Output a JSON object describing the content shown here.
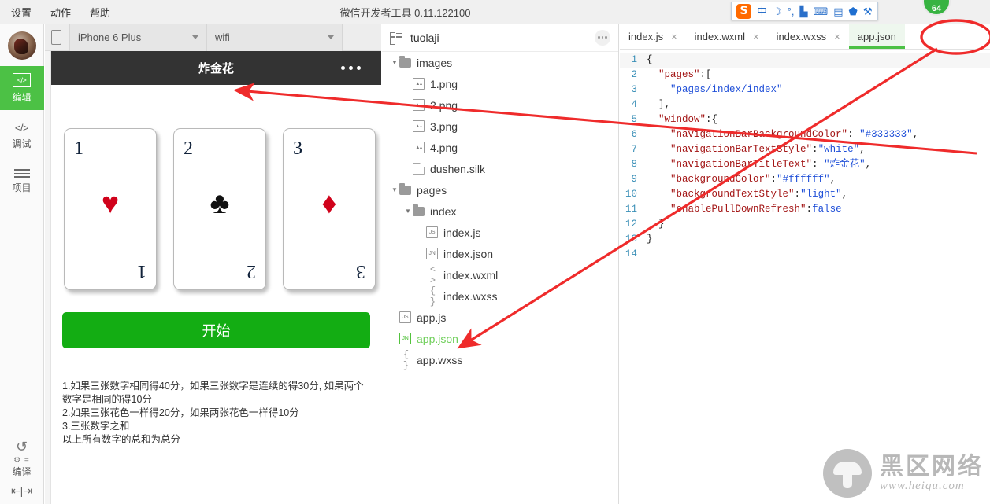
{
  "window": {
    "title": "微信开发者工具 0.11.122100",
    "badge": "64"
  },
  "menubar": {
    "items": [
      {
        "label": "设置",
        "name": "menu-settings"
      },
      {
        "label": "动作",
        "name": "menu-actions"
      },
      {
        "label": "帮助",
        "name": "menu-help"
      }
    ]
  },
  "ime": {
    "logo": "S",
    "icons": [
      "中",
      "☽",
      "°,",
      "▙",
      "⌨",
      "▤",
      "⬟",
      "⚒"
    ]
  },
  "rail": {
    "items": [
      {
        "label": "编辑",
        "glyph": "</>",
        "active": true,
        "name": "rail-edit"
      },
      {
        "label": "调试",
        "glyph": "</>",
        "active": false,
        "name": "rail-debug"
      },
      {
        "label": "项目",
        "glyph": "hamburger",
        "active": false,
        "name": "rail-project"
      }
    ],
    "compile_label": "编译",
    "compile_sub": "⚙ ="
  },
  "simulator": {
    "device": "iPhone 6 Plus",
    "network": "wifi",
    "navbar_title": "炸金花",
    "cards": [
      {
        "number": "1",
        "suit": "♥",
        "color": "red"
      },
      {
        "number": "2",
        "suit": "♣",
        "color": "black"
      },
      {
        "number": "3",
        "suit": "♦",
        "color": "red"
      }
    ],
    "start_button": "开始",
    "rules": [
      "1.如果三张数字相同得40分，如果三张数字是连续的得30分, 如果两个数字是相同的得10分",
      "2.如果三张花色一样得20分，如果两张花色一样得10分",
      "3.三张数字之和",
      "以上所有数字的总和为总分"
    ]
  },
  "tree": {
    "project_name": "tuolaji",
    "nodes": [
      {
        "label": "images",
        "type": "folder",
        "depth": 0,
        "open": true
      },
      {
        "label": "1.png",
        "type": "img",
        "depth": 1
      },
      {
        "label": "2.png",
        "type": "img",
        "depth": 1
      },
      {
        "label": "3.png",
        "type": "img",
        "depth": 1
      },
      {
        "label": "4.png",
        "type": "img",
        "depth": 1
      },
      {
        "label": "dushen.silk",
        "type": "plain",
        "depth": 1
      },
      {
        "label": "pages",
        "type": "folder",
        "depth": 0,
        "open": true
      },
      {
        "label": "index",
        "type": "folder",
        "depth": 1,
        "open": true
      },
      {
        "label": "index.js",
        "type": "js",
        "depth": 2
      },
      {
        "label": "index.json",
        "type": "jn",
        "depth": 2
      },
      {
        "label": "index.wxml",
        "type": "wxml",
        "depth": 2
      },
      {
        "label": "index.wxss",
        "type": "wxss",
        "depth": 2
      },
      {
        "label": "app.js",
        "type": "js",
        "depth": 0
      },
      {
        "label": "app.json",
        "type": "jn",
        "depth": 0,
        "selected": true
      },
      {
        "label": "app.wxss",
        "type": "wxss",
        "depth": 0
      }
    ]
  },
  "editor": {
    "tabs": [
      {
        "label": "index.js",
        "active": false,
        "closable": true
      },
      {
        "label": "index.wxml",
        "active": false,
        "closable": true
      },
      {
        "label": "index.wxss",
        "active": false,
        "closable": true
      },
      {
        "label": "app.json",
        "active": true,
        "closable": false,
        "circled": true
      }
    ],
    "lines": [
      {
        "n": "1",
        "text": "{"
      },
      {
        "n": "2",
        "text": "  \"pages\":["
      },
      {
        "n": "3",
        "text": "    \"pages/index/index\""
      },
      {
        "n": "4",
        "text": "  ],"
      },
      {
        "n": "5",
        "text": "  \"window\":{"
      },
      {
        "n": "6",
        "text": "    \"navigationBarBackgroundColor\": \"#333333\","
      },
      {
        "n": "7",
        "text": "    \"navigationBarTextStyle\":\"white\","
      },
      {
        "n": "8",
        "text": "    \"navigationBarTitleText\": \"炸金花\","
      },
      {
        "n": "9",
        "text": "    \"backgroundColor\":\"#ffffff\","
      },
      {
        "n": "10",
        "text": "    \"backgroundTextStyle\":\"light\","
      },
      {
        "n": "11",
        "text": "    \"enablePullDownRefresh\":false"
      },
      {
        "n": "12",
        "text": "  }"
      },
      {
        "n": "13",
        "text": "}"
      },
      {
        "n": "14",
        "text": ""
      }
    ]
  },
  "watermark": {
    "cn": "黑区网络",
    "url": "www.heiqu.com"
  },
  "colors": {
    "accent_green": "#4cc145",
    "button_green": "#13ad13",
    "navbar_dark": "#333333",
    "annotation_red": "#ef2b2b"
  }
}
